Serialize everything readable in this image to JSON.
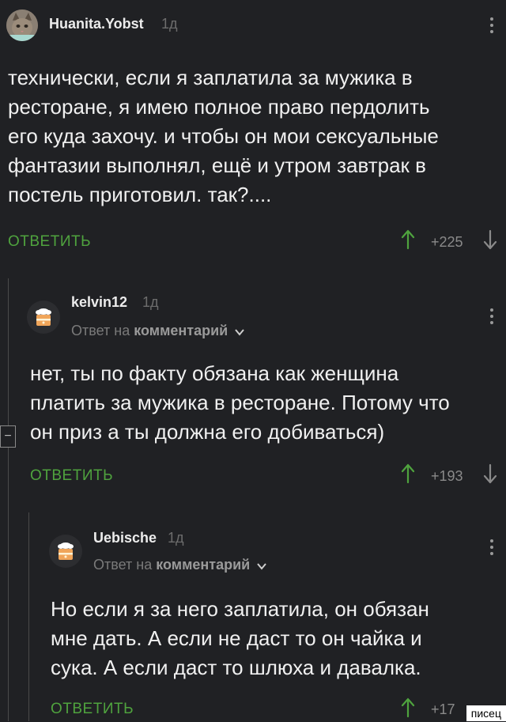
{
  "comments": [
    {
      "username": "Huanita.Yobst",
      "time": "1д",
      "text_lines": [
        "технически, если я заплатила за мужика в",
        "ресторане, я имею полное право пердолить",
        "его куда захочу. и чтобы он мои сексуальные",
        "фантазии выполнял, ещё и утром завтрак в",
        "постель приготовил. так?...."
      ],
      "reply_label": "ОТВЕТИТЬ",
      "score": "+225"
    },
    {
      "username": "kelvin12",
      "time": "1д",
      "reply_prefix": "Ответ на",
      "reply_target": "комментарий",
      "text_lines": [
        "нет, ты по факту обязана как женщина",
        "платить за мужика в ресторане. Потому что",
        "он приз а ты должна его добиваться)"
      ],
      "reply_label": "ОТВЕТИТЬ",
      "score": "+193"
    },
    {
      "username": "Uebische",
      "time": "1д",
      "reply_prefix": "Ответ на",
      "reply_target": "комментарий",
      "text_lines": [
        "Но если я за него заплатила, он обязан",
        "мне дать. А если не даст то он чайка и",
        "сука. А если даст то шлюха и давалка."
      ],
      "reply_label": "ОТВЕТИТЬ",
      "score": "+17"
    }
  ],
  "collapse_glyph": "−",
  "watermark": "писец",
  "colors": {
    "background": "#202124",
    "accent_green": "#4fa33e",
    "muted": "#8a8a8a"
  }
}
